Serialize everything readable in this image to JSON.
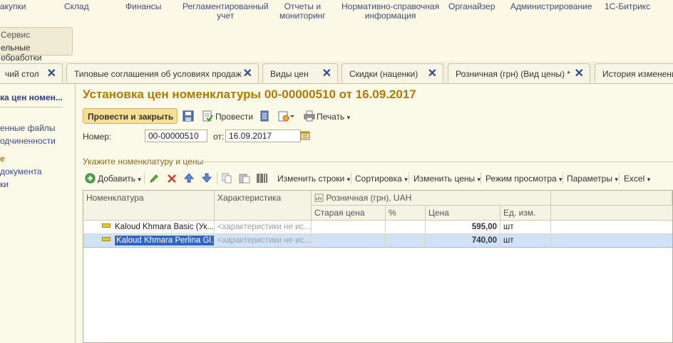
{
  "top_nav": [
    "акупки",
    "Склад",
    "Финансы",
    "Регламентированный\nучет",
    "Отчеты и\nмониторинг",
    "Нормативно-справочная\nинформация",
    "Органайзер",
    "Администрирование",
    "1С-Битрикс"
  ],
  "service_menu": {
    "line1": "Сервис",
    "line2": "ельные обработки"
  },
  "tabs": [
    "чий стол",
    "Типовые соглашения об условиях продаж",
    "Виды цен",
    "Скидки (наценки)",
    "Розничная (грн) (Вид цены) *",
    "История изменения"
  ],
  "tab_close": "✕",
  "left_panel": {
    "items": [
      "ка цен номен...",
      "енные файлы",
      "одчиненности",
      "е",
      " документа",
      "ки"
    ]
  },
  "document": {
    "title": "Установка цен номенклатуры 00-00000510 от 16.09.2017",
    "post_close_label": "Провести и закрыть",
    "post_label": "Провести",
    "print_label": "Печать",
    "number_label": "Номер:",
    "number_value": "00-00000510",
    "date_label": "от:",
    "date_value": "16.09.2017",
    "section_label": "Укажите номенклатуру и цены"
  },
  "grid_toolbar": {
    "add": "Добавить",
    "change_rows": "Изменить строки",
    "sort": "Сортировка",
    "change_prices": "Изменить цены",
    "view_mode": "Режим просмотра",
    "params": "Параметры",
    "excel": "Excel"
  },
  "grid": {
    "headers": {
      "item": "Номенклатура",
      "characteristic": "Характеристика",
      "price_group": "Розничная (грн), UAH",
      "old_price": "Старая цена",
      "percent": "%",
      "price": "Цена",
      "unit": "Ед. изм."
    },
    "rows": [
      {
        "item": "Kaloud Khmara Basic (Ук...",
        "characteristic": "<характеристики не ис...",
        "old_price": "",
        "percent": "",
        "price": "595,00",
        "unit": "шт"
      },
      {
        "item": "Kaloud Khmara Perlina Gl...",
        "characteristic": "<характеристики не ис...",
        "old_price": "",
        "percent": "",
        "price": "740,00",
        "unit": "шт"
      }
    ]
  },
  "colors": {
    "title": "#b07a00",
    "accent_button": "#f6de93",
    "selected_row": "#cfe2f7",
    "link": "#3a4a8c"
  }
}
